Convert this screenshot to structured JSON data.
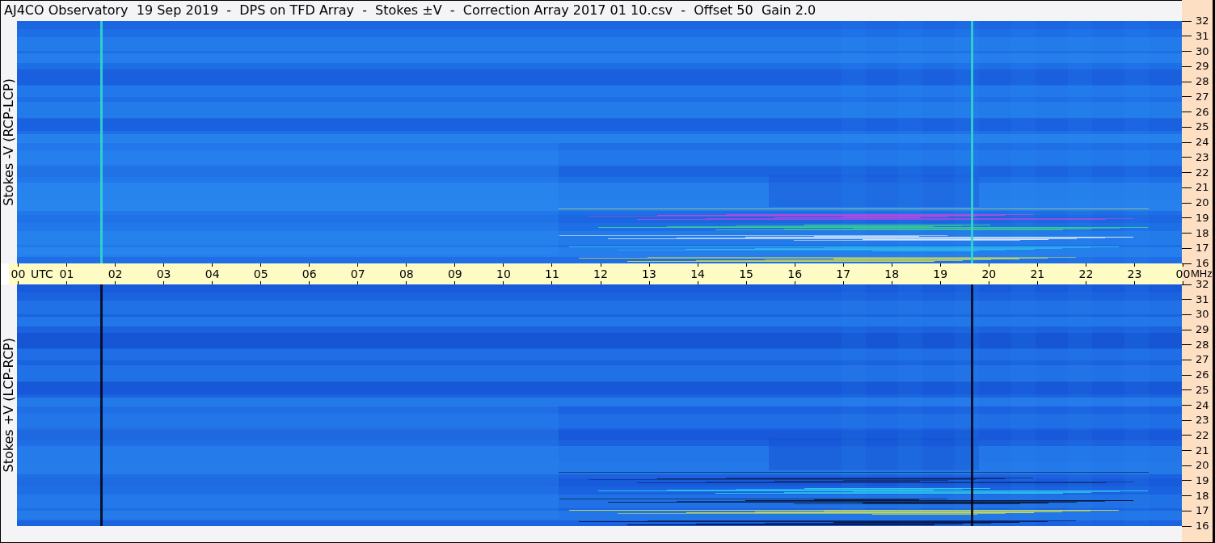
{
  "title": "AJ4CO Observatory  19 Sep 2019  -  DPS on TFD Array  -  Stokes ±V  -  Correction Array 2017 01 10.csv  -  Offset 50  Gain 2.0",
  "panels": [
    {
      "kind": "minus",
      "label": "Stokes -V (RCP-LCP)",
      "freq_ticks": [
        "32",
        "31",
        "30",
        "29",
        "28",
        "27",
        "26",
        "25",
        "24",
        "23",
        "22",
        "21",
        "20",
        "19",
        "18",
        "17",
        "16"
      ]
    },
    {
      "kind": "plus",
      "label": "Stokes +V (LCP-RCP)",
      "freq_ticks": [
        "32",
        "31",
        "30",
        "29",
        "28",
        "27",
        "26",
        "25",
        "24",
        "23",
        "22",
        "21",
        "20",
        "19",
        "18",
        "17",
        "16"
      ]
    }
  ],
  "time_axis": {
    "start_unit": "UTC",
    "end_unit": "MHz",
    "ticks": [
      "00",
      "01",
      "02",
      "03",
      "04",
      "05",
      "06",
      "07",
      "08",
      "09",
      "10",
      "11",
      "12",
      "13",
      "14",
      "15",
      "16",
      "17",
      "18",
      "19",
      "20",
      "21",
      "22",
      "23",
      "00"
    ]
  }
}
